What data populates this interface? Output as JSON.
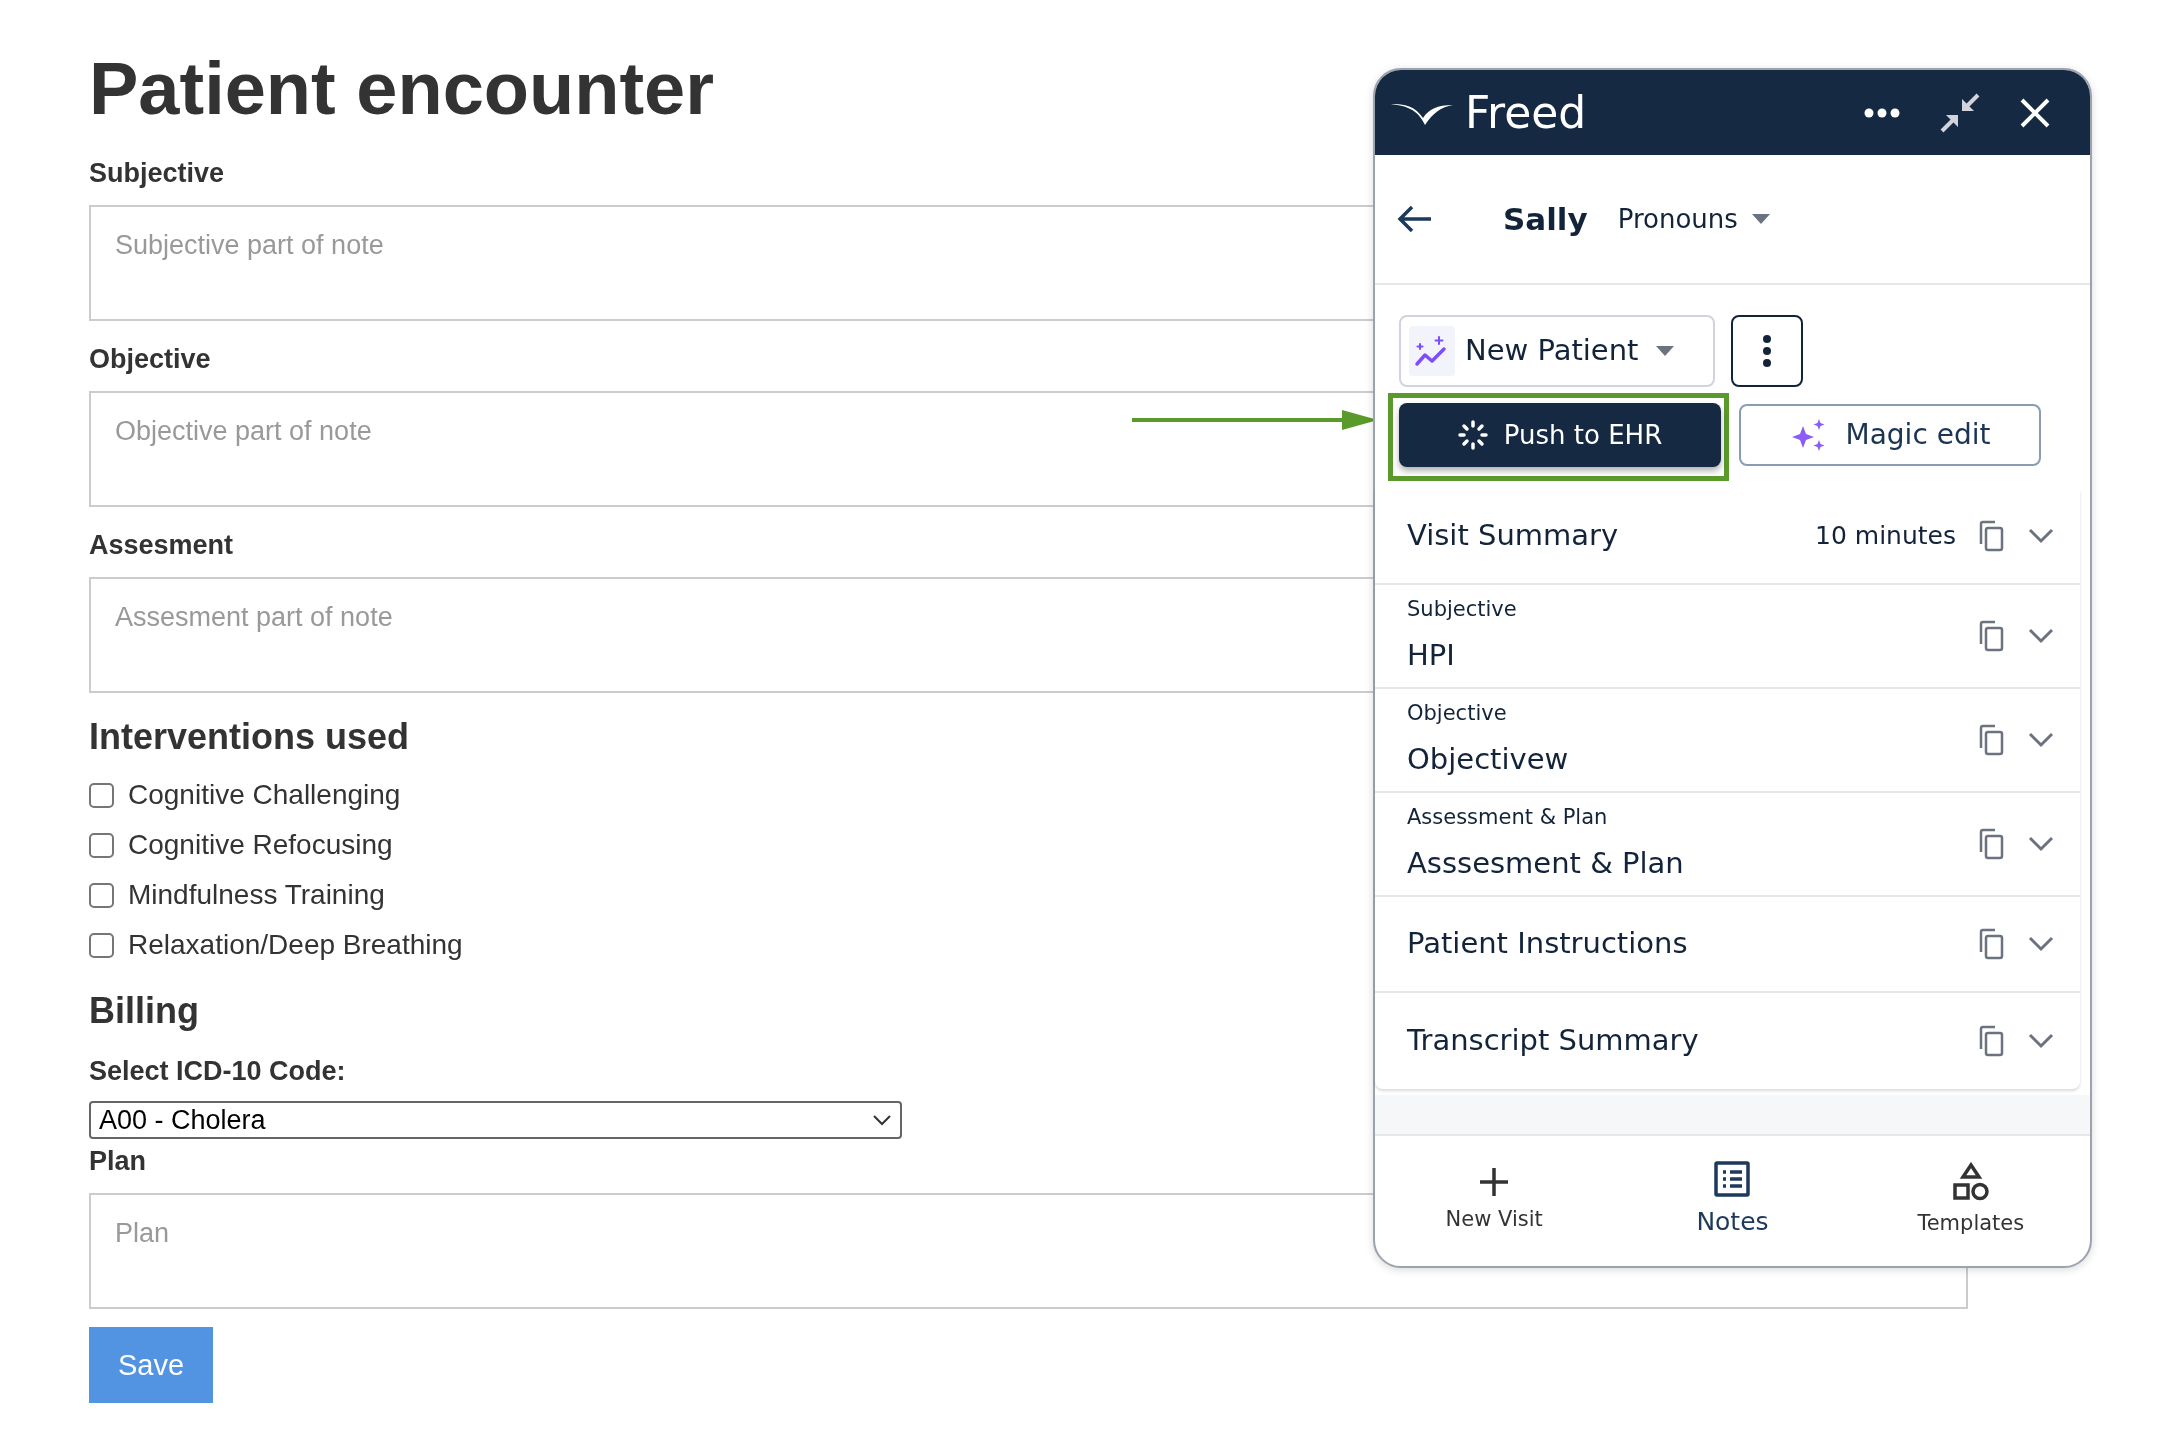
{
  "page": {
    "title": "Patient encounter"
  },
  "fields": [
    {
      "label": "Subjective",
      "placeholder": "Subjective part of note"
    },
    {
      "label": "Objective",
      "placeholder": "Objective part of note"
    },
    {
      "label": "Assesment",
      "placeholder": "Assesment part of note"
    }
  ],
  "interventions": {
    "heading": "Interventions used",
    "items": [
      {
        "label": "Cognitive Challenging",
        "checked": false
      },
      {
        "label": "Cognitive Refocusing",
        "checked": false
      },
      {
        "label": "Mindfulness Training",
        "checked": false
      },
      {
        "label": "Relaxation/Deep Breathing",
        "checked": false
      }
    ]
  },
  "billing": {
    "heading": "Billing",
    "select_label": "Select ICD-10 Code:",
    "select_value": "A00 - Cholera"
  },
  "plan": {
    "label": "Plan",
    "placeholder": "Plan"
  },
  "save_button": "Save",
  "panel": {
    "brand": "Freed",
    "patient_name": "Sally",
    "pronouns": "Pronouns",
    "template": "New Patient",
    "push_button": "Push to EHR",
    "magic_button": "Magic edit",
    "sections": [
      {
        "title": "Visit Summary",
        "meta": "10 minutes"
      },
      {
        "category": "Subjective",
        "title": "HPI"
      },
      {
        "category": "Objective",
        "title": "Objectivew"
      },
      {
        "category": "Assessment & Plan",
        "title": "Asssesment & Plan"
      },
      {
        "title": "Patient Instructions"
      },
      {
        "title": "Transcript Summary"
      }
    ],
    "nav": [
      {
        "kind": "plus",
        "label": "New Visit",
        "selected": false
      },
      {
        "kind": "notes",
        "label": "Notes",
        "selected": true
      },
      {
        "kind": "shapes",
        "label": "Templates",
        "selected": false
      }
    ]
  }
}
